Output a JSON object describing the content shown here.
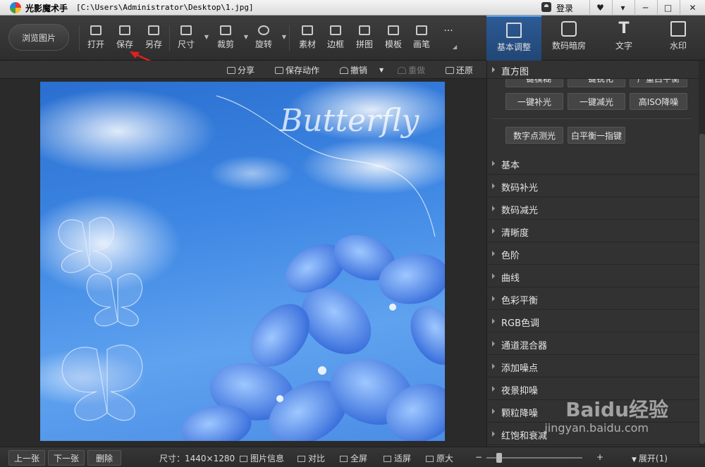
{
  "window": {
    "app_name": "光影魔术手",
    "file_path": "[C:\\Users\\Administrator\\Desktop\\1.jpg]",
    "login_label": "登录",
    "controls": [
      "♥",
      "▾",
      "─",
      "□",
      "✕"
    ]
  },
  "toolbar": {
    "browse_label": "浏览图片",
    "tools": [
      {
        "label": "打开",
        "icon": "open-icon"
      },
      {
        "label": "保存",
        "icon": "save-icon"
      },
      {
        "label": "另存",
        "icon": "save-as-icon"
      },
      {
        "label": "尺寸",
        "icon": "resize-icon"
      },
      {
        "label": "裁剪",
        "icon": "crop-icon"
      },
      {
        "label": "旋转",
        "icon": "rotate-icon"
      },
      {
        "label": "素材",
        "icon": "material-icon"
      },
      {
        "label": "边框",
        "icon": "border-icon"
      },
      {
        "label": "拼图",
        "icon": "collage-icon"
      },
      {
        "label": "模板",
        "icon": "template-icon"
      },
      {
        "label": "画笔",
        "icon": "brush-icon"
      }
    ],
    "more_label": "···"
  },
  "tabs": [
    {
      "label": "基本调整",
      "icon": "adjust-icon"
    },
    {
      "label": "数码暗房",
      "icon": "darkroom-icon"
    },
    {
      "label": "文字",
      "icon": "text-icon"
    },
    {
      "label": "水印",
      "icon": "watermark-icon"
    }
  ],
  "actions": {
    "share": "分享",
    "save_action": "保存动作",
    "undo": "撤销",
    "redo": "重做",
    "restore": "还原"
  },
  "photo": {
    "title_text": "Butterfly"
  },
  "panel": {
    "histogram_title": "直方图",
    "quick_buttons_partial": [
      "一键模糊",
      "一键锐化",
      "严重白平衡"
    ],
    "quick_buttons": [
      "一键补光",
      "一键减光",
      "高ISO降噪",
      "数字点测光",
      "白平衡一指键"
    ],
    "sections": [
      "基本",
      "数码补光",
      "数码减光",
      "清晰度",
      "色阶",
      "曲线",
      "色彩平衡",
      "RGB色调",
      "通道混合器",
      "添加噪点",
      "夜景抑噪",
      "颗粒降噪",
      "红饱和衰减"
    ]
  },
  "status": {
    "prev": "上一张",
    "next": "下一张",
    "delete": "删除",
    "size_label": "尺寸：1440×1280",
    "info": "图片信息",
    "compare": "对比",
    "fullscreen": "全屏",
    "fit": "适屏",
    "original": "原大",
    "minus": "−",
    "plus": "+",
    "expand": "展开(1)"
  },
  "watermark": {
    "brand": "Baidu经验",
    "site": "jingyan.baidu.com"
  },
  "colors": {
    "active_tab": "#2d5b95",
    "annotation_arrow": "#e0201e"
  }
}
